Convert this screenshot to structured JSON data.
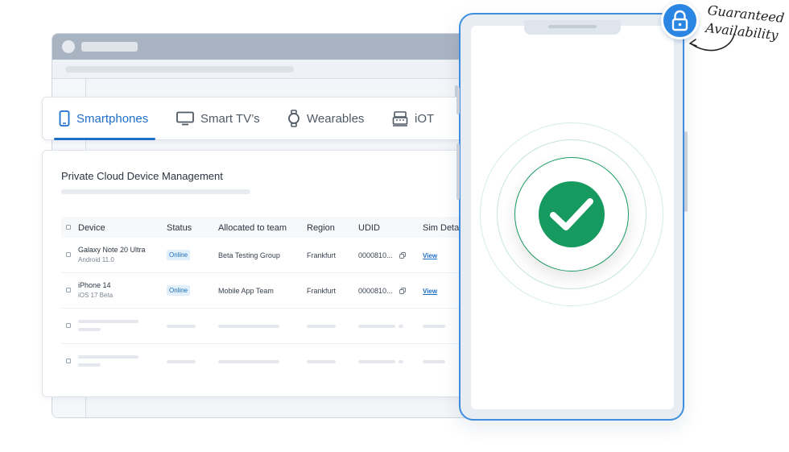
{
  "tabs": [
    {
      "label": "Smartphones",
      "icon": "smartphone-icon",
      "active": true
    },
    {
      "label": "Smart TV’s",
      "icon": "tv-icon",
      "active": false
    },
    {
      "label": "Wearables",
      "icon": "watch-icon",
      "active": false
    },
    {
      "label": "iOT",
      "icon": "iot-device-icon",
      "active": false
    }
  ],
  "panel": {
    "title": "Private Cloud Device Management"
  },
  "table": {
    "headers": [
      "Device",
      "Status",
      "Allocated to team",
      "Region",
      "UDID",
      "Sim Deta"
    ],
    "rows": [
      {
        "device": "Galaxy Note 20 Ultra",
        "os": "Android 11.0",
        "status": "Online",
        "team": "Beta Testing Group",
        "region": "Frankfurt",
        "udid": "0000810...",
        "sim": "View"
      },
      {
        "device": "iPhone 14",
        "os": "iOS 17 Beta",
        "status": "Online",
        "team": "Mobile App Team",
        "region": "Frankfurt",
        "udid": "0000810...",
        "sim": "View"
      }
    ]
  },
  "annotation": {
    "line1": "Guaranteed",
    "line2": "Availability"
  },
  "colors": {
    "accent": "#1f6fc9",
    "success": "#179a5f",
    "badge_bg": "#e2f0fb"
  }
}
